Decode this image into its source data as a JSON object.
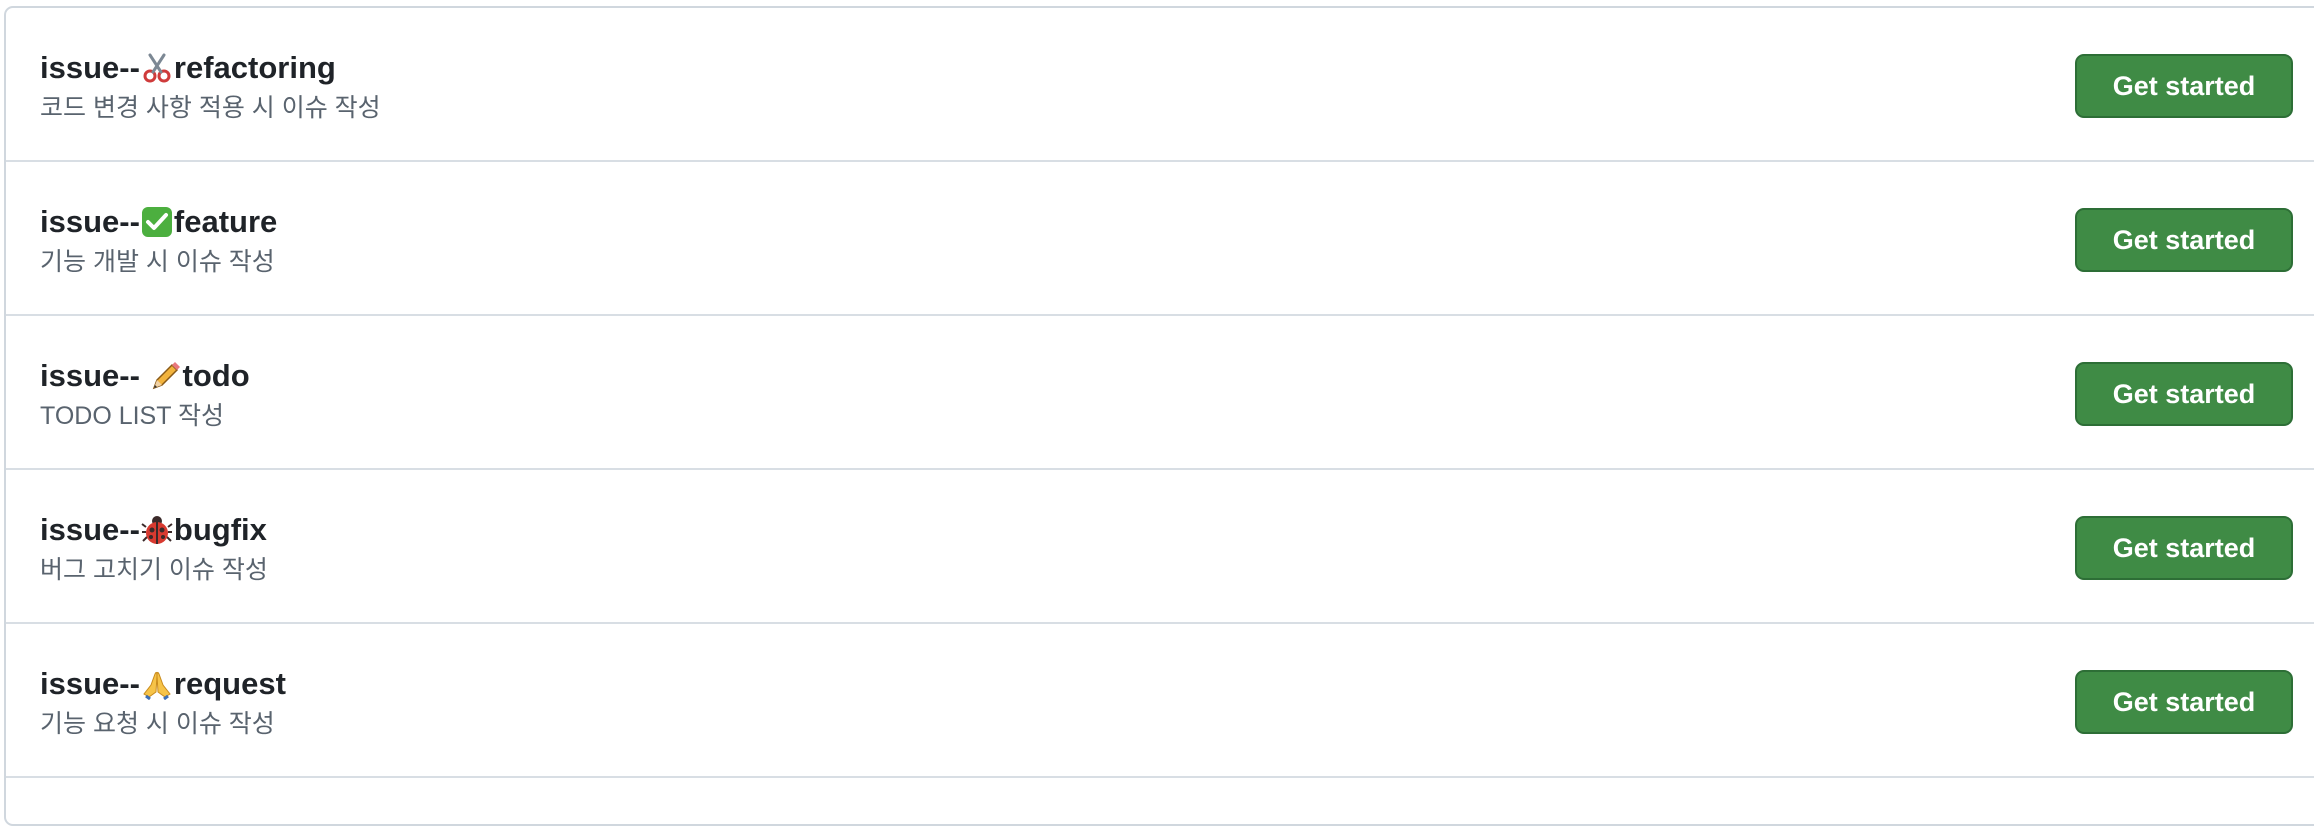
{
  "templates": [
    {
      "prefix": "issue--",
      "icon": "scissors-icon",
      "name": "refactoring",
      "description": "코드 변경 사항 적용 시 이슈 작성",
      "button_label": "Get started"
    },
    {
      "prefix": "issue--",
      "icon": "check-mark-icon",
      "name": "feature",
      "description": "기능 개발 시 이슈 작성",
      "button_label": "Get started"
    },
    {
      "prefix": "issue-- ",
      "icon": "pencil-icon",
      "name": "todo",
      "description": "TODO LIST 작성",
      "button_label": "Get started"
    },
    {
      "prefix": "issue--",
      "icon": "ladybug-icon",
      "name": "bugfix",
      "description": "버그 고치기 이슈 작성",
      "button_label": "Get started"
    },
    {
      "prefix": "issue--",
      "icon": "folded-hands-icon",
      "name": "request",
      "description": "기능 요청 시 이슈 작성",
      "button_label": "Get started"
    }
  ],
  "colors": {
    "button_background": "#3f8b45",
    "button_border": "#2d6e36",
    "title": "#1f2328",
    "description": "#59636e",
    "divider": "#d8dee4"
  }
}
